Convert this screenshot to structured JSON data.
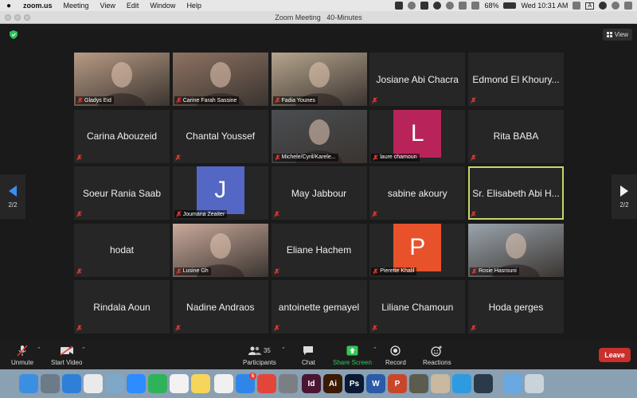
{
  "menubar": {
    "app_name": "zoom.us",
    "items": [
      "Meeting",
      "View",
      "Edit",
      "Window",
      "Help"
    ],
    "battery": "68%",
    "datetime": "Wed 10:31 AM",
    "input_source": "A"
  },
  "window": {
    "title": "Zoom Meeting   40-Minutes"
  },
  "view_button": {
    "label": "View"
  },
  "pager": {
    "left": "2/2",
    "right": "2/2"
  },
  "participants": [
    {
      "name": "Gladys Eid",
      "kind": "photo",
      "color": "#b89b84"
    },
    {
      "name": "Carine Farah Sassine",
      "kind": "photo",
      "color": "#8d7262"
    },
    {
      "name": "Fadia Younes",
      "kind": "photo",
      "color": "#b6a58e"
    },
    {
      "name": "Josiane Abi Chacra",
      "kind": "text"
    },
    {
      "name": "Edmond El Khoury...",
      "kind": "text"
    },
    {
      "name": "Carina Abouzeid",
      "kind": "text"
    },
    {
      "name": "Chantal Youssef",
      "kind": "text"
    },
    {
      "name": "Michele/Cyril/Karele...",
      "kind": "photo",
      "color": "#4a4e52"
    },
    {
      "name": "laure chamoun",
      "kind": "avatar",
      "letter": "L",
      "color": "#b8245a"
    },
    {
      "name": "Rita BABA",
      "kind": "text"
    },
    {
      "name": "Soeur Rania Saab",
      "kind": "text"
    },
    {
      "name": "Joumana Zeaiter",
      "kind": "avatar",
      "letter": "J",
      "color": "#5567c4"
    },
    {
      "name": "May Jabbour",
      "kind": "text"
    },
    {
      "name": "sabine akoury",
      "kind": "text"
    },
    {
      "name": "Sr. Elisabeth Abi H...",
      "kind": "text",
      "active": true
    },
    {
      "name": "hodat",
      "kind": "text"
    },
    {
      "name": "Lusine Gh",
      "kind": "photo",
      "color": "#c9a99b"
    },
    {
      "name": "Eliane Hachem",
      "kind": "text"
    },
    {
      "name": "Pierette Khalil",
      "kind": "avatar",
      "letter": "P",
      "color": "#e8522b"
    },
    {
      "name": "Rosie Hasrouni",
      "kind": "photo",
      "color": "#9aa4ad"
    },
    {
      "name": "Rindala Aoun",
      "kind": "text"
    },
    {
      "name": "Nadine Andraos",
      "kind": "text"
    },
    {
      "name": "antoinette gemayel",
      "kind": "text"
    },
    {
      "name": "Liliane Chamoun",
      "kind": "text"
    },
    {
      "name": "Hoda gerges",
      "kind": "text"
    }
  ],
  "toolbar": {
    "unmute": "Unmute",
    "start_video": "Start Video",
    "participants": "Participants",
    "participants_count": "35",
    "chat": "Chat",
    "share_screen": "Share Screen",
    "record": "Record",
    "reactions": "Reactions",
    "leave": "Leave"
  },
  "dock": {
    "apps": [
      {
        "id": "finder",
        "color": "#3b8fe0",
        "glyph": ""
      },
      {
        "id": "launchpad",
        "color": "#6d7a88",
        "glyph": ""
      },
      {
        "id": "safari",
        "color": "#2e7fd8",
        "glyph": ""
      },
      {
        "id": "chrome",
        "color": "#e9eaeb",
        "glyph": ""
      },
      {
        "id": "preview",
        "color": "#7ea7c8",
        "glyph": ""
      },
      {
        "id": "zoom",
        "color": "#2d8cff",
        "glyph": ""
      },
      {
        "id": "facetime",
        "color": "#2fb35a",
        "glyph": ""
      },
      {
        "id": "photos",
        "color": "#f2f2f2",
        "glyph": ""
      },
      {
        "id": "notes",
        "color": "#f6d65a",
        "glyph": ""
      },
      {
        "id": "itunes",
        "color": "#f0f0f0",
        "glyph": ""
      },
      {
        "id": "appstore",
        "color": "#2f86e8",
        "glyph": "",
        "badge": "5"
      },
      {
        "id": "anydesk",
        "color": "#e2463a",
        "glyph": ""
      },
      {
        "id": "settings",
        "color": "#7b7f84",
        "glyph": ""
      },
      {
        "id": "indesign",
        "color": "#4a1532",
        "glyph": "Id"
      },
      {
        "id": "illustrator",
        "color": "#3a1a02",
        "glyph": "Ai"
      },
      {
        "id": "photoshop",
        "color": "#0a1a35",
        "glyph": "Ps"
      },
      {
        "id": "word",
        "color": "#2b5ba8",
        "glyph": "W"
      },
      {
        "id": "powerpoint",
        "color": "#c8472a",
        "glyph": "P"
      },
      {
        "id": "game",
        "color": "#5b5b4e",
        "glyph": ""
      },
      {
        "id": "photo-app",
        "color": "#c9b9a0",
        "glyph": ""
      },
      {
        "id": "accessibility",
        "color": "#2e9be0",
        "glyph": ""
      },
      {
        "id": "quicktime",
        "color": "#2a3a4a",
        "glyph": ""
      },
      {
        "id": "folder",
        "color": "#69a8e0",
        "glyph": ""
      },
      {
        "id": "trash",
        "color": "#c9d3dc",
        "glyph": ""
      }
    ]
  }
}
